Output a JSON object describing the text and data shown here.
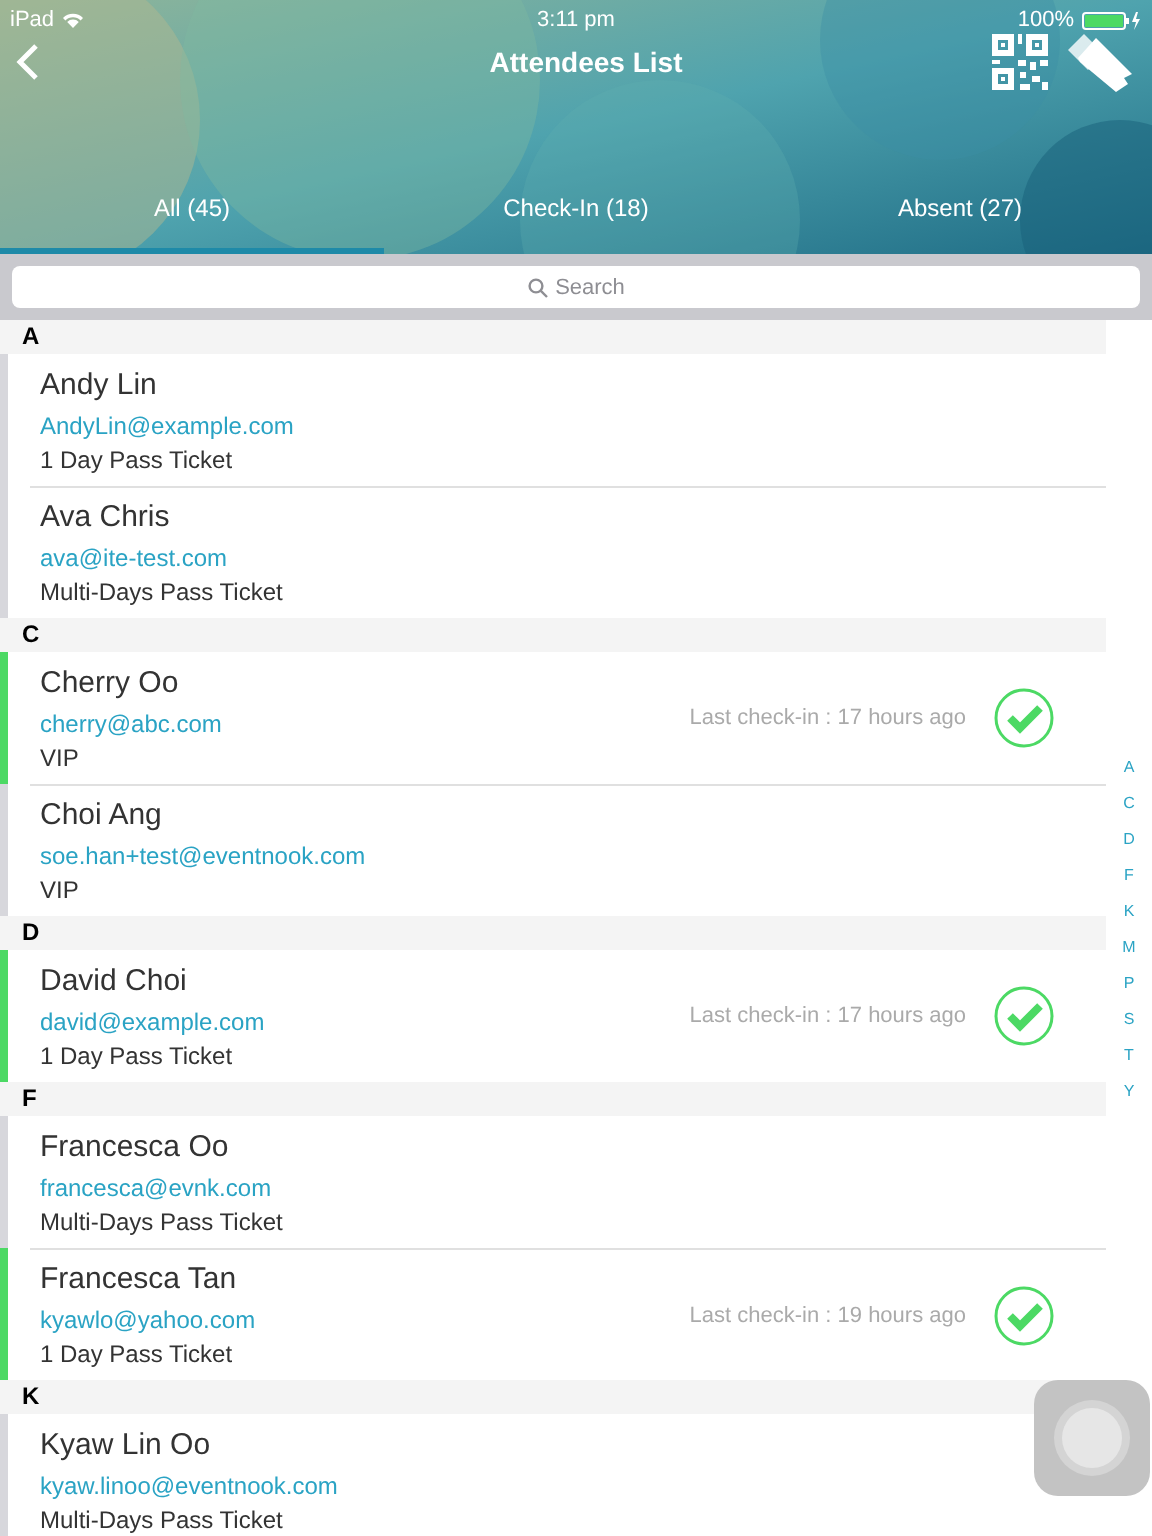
{
  "status_bar": {
    "device": "iPad",
    "time": "3:11 pm",
    "battery": "100%"
  },
  "nav": {
    "title": "Attendees List"
  },
  "tabs": [
    {
      "label": "All (45)",
      "selected": true
    },
    {
      "label": "Check-In (18)",
      "selected": false
    },
    {
      "label": "Absent (27)",
      "selected": false
    }
  ],
  "search": {
    "placeholder": "Search"
  },
  "sections": [
    {
      "letter": "A",
      "rows": [
        {
          "name": "Andy Lin",
          "email": "AndyLin@example.com",
          "ticket": "1 Day Pass Ticket",
          "checked_in": false
        },
        {
          "name": "Ava Chris",
          "email": "ava@ite-test.com",
          "ticket": "Multi-Days Pass Ticket",
          "checked_in": false
        }
      ]
    },
    {
      "letter": "C",
      "rows": [
        {
          "name": "Cherry Oo",
          "email": "cherry@abc.com",
          "ticket": "VIP",
          "checked_in": true,
          "last_checkin": "Last check-in : 17 hours ago"
        },
        {
          "name": "Choi Ang",
          "email": "soe.han+test@eventnook.com",
          "ticket": "VIP",
          "checked_in": false
        }
      ]
    },
    {
      "letter": "D",
      "rows": [
        {
          "name": "David Choi",
          "email": "david@example.com",
          "ticket": "1 Day Pass Ticket",
          "checked_in": true,
          "last_checkin": "Last check-in : 17 hours ago"
        }
      ]
    },
    {
      "letter": "F",
      "rows": [
        {
          "name": "Francesca Oo",
          "email": "francesca@evnk.com",
          "ticket": "Multi-Days Pass Ticket",
          "checked_in": false
        },
        {
          "name": "Francesca Tan",
          "email": "kyawlo@yahoo.com",
          "ticket": "1 Day Pass Ticket",
          "checked_in": true,
          "last_checkin": "Last check-in : 19 hours ago"
        }
      ]
    },
    {
      "letter": "K",
      "rows": [
        {
          "name": "Kyaw Lin Oo",
          "email": "kyaw.linoo@eventnook.com",
          "ticket": "Multi-Days Pass Ticket",
          "checked_in": false
        }
      ]
    }
  ],
  "index_letters": [
    "A",
    "C",
    "D",
    "F",
    "K",
    "M",
    "P",
    "S",
    "T",
    "Y"
  ]
}
